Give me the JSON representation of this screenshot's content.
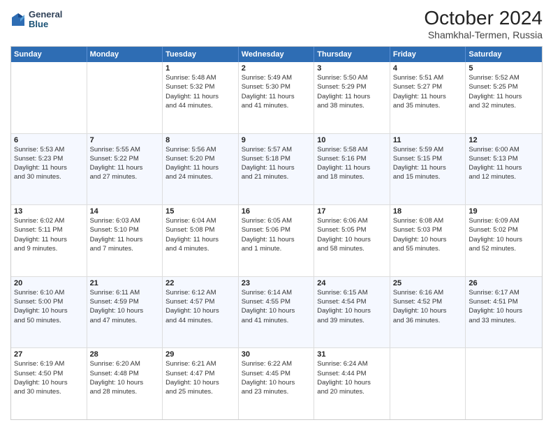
{
  "logo": {
    "line1": "General",
    "line2": "Blue"
  },
  "title": "October 2024",
  "subtitle": "Shamkhal-Termen, Russia",
  "header_days": [
    "Sunday",
    "Monday",
    "Tuesday",
    "Wednesday",
    "Thursday",
    "Friday",
    "Saturday"
  ],
  "rows": [
    {
      "alt": false,
      "cells": [
        {
          "day": "",
          "lines": []
        },
        {
          "day": "",
          "lines": []
        },
        {
          "day": "1",
          "lines": [
            "Sunrise: 5:48 AM",
            "Sunset: 5:32 PM",
            "Daylight: 11 hours",
            "and 44 minutes."
          ]
        },
        {
          "day": "2",
          "lines": [
            "Sunrise: 5:49 AM",
            "Sunset: 5:30 PM",
            "Daylight: 11 hours",
            "and 41 minutes."
          ]
        },
        {
          "day": "3",
          "lines": [
            "Sunrise: 5:50 AM",
            "Sunset: 5:29 PM",
            "Daylight: 11 hours",
            "and 38 minutes."
          ]
        },
        {
          "day": "4",
          "lines": [
            "Sunrise: 5:51 AM",
            "Sunset: 5:27 PM",
            "Daylight: 11 hours",
            "and 35 minutes."
          ]
        },
        {
          "day": "5",
          "lines": [
            "Sunrise: 5:52 AM",
            "Sunset: 5:25 PM",
            "Daylight: 11 hours",
            "and 32 minutes."
          ]
        }
      ]
    },
    {
      "alt": true,
      "cells": [
        {
          "day": "6",
          "lines": [
            "Sunrise: 5:53 AM",
            "Sunset: 5:23 PM",
            "Daylight: 11 hours",
            "and 30 minutes."
          ]
        },
        {
          "day": "7",
          "lines": [
            "Sunrise: 5:55 AM",
            "Sunset: 5:22 PM",
            "Daylight: 11 hours",
            "and 27 minutes."
          ]
        },
        {
          "day": "8",
          "lines": [
            "Sunrise: 5:56 AM",
            "Sunset: 5:20 PM",
            "Daylight: 11 hours",
            "and 24 minutes."
          ]
        },
        {
          "day": "9",
          "lines": [
            "Sunrise: 5:57 AM",
            "Sunset: 5:18 PM",
            "Daylight: 11 hours",
            "and 21 minutes."
          ]
        },
        {
          "day": "10",
          "lines": [
            "Sunrise: 5:58 AM",
            "Sunset: 5:16 PM",
            "Daylight: 11 hours",
            "and 18 minutes."
          ]
        },
        {
          "day": "11",
          "lines": [
            "Sunrise: 5:59 AM",
            "Sunset: 5:15 PM",
            "Daylight: 11 hours",
            "and 15 minutes."
          ]
        },
        {
          "day": "12",
          "lines": [
            "Sunrise: 6:00 AM",
            "Sunset: 5:13 PM",
            "Daylight: 11 hours",
            "and 12 minutes."
          ]
        }
      ]
    },
    {
      "alt": false,
      "cells": [
        {
          "day": "13",
          "lines": [
            "Sunrise: 6:02 AM",
            "Sunset: 5:11 PM",
            "Daylight: 11 hours",
            "and 9 minutes."
          ]
        },
        {
          "day": "14",
          "lines": [
            "Sunrise: 6:03 AM",
            "Sunset: 5:10 PM",
            "Daylight: 11 hours",
            "and 7 minutes."
          ]
        },
        {
          "day": "15",
          "lines": [
            "Sunrise: 6:04 AM",
            "Sunset: 5:08 PM",
            "Daylight: 11 hours",
            "and 4 minutes."
          ]
        },
        {
          "day": "16",
          "lines": [
            "Sunrise: 6:05 AM",
            "Sunset: 5:06 PM",
            "Daylight: 11 hours",
            "and 1 minute."
          ]
        },
        {
          "day": "17",
          "lines": [
            "Sunrise: 6:06 AM",
            "Sunset: 5:05 PM",
            "Daylight: 10 hours",
            "and 58 minutes."
          ]
        },
        {
          "day": "18",
          "lines": [
            "Sunrise: 6:08 AM",
            "Sunset: 5:03 PM",
            "Daylight: 10 hours",
            "and 55 minutes."
          ]
        },
        {
          "day": "19",
          "lines": [
            "Sunrise: 6:09 AM",
            "Sunset: 5:02 PM",
            "Daylight: 10 hours",
            "and 52 minutes."
          ]
        }
      ]
    },
    {
      "alt": true,
      "cells": [
        {
          "day": "20",
          "lines": [
            "Sunrise: 6:10 AM",
            "Sunset: 5:00 PM",
            "Daylight: 10 hours",
            "and 50 minutes."
          ]
        },
        {
          "day": "21",
          "lines": [
            "Sunrise: 6:11 AM",
            "Sunset: 4:59 PM",
            "Daylight: 10 hours",
            "and 47 minutes."
          ]
        },
        {
          "day": "22",
          "lines": [
            "Sunrise: 6:12 AM",
            "Sunset: 4:57 PM",
            "Daylight: 10 hours",
            "and 44 minutes."
          ]
        },
        {
          "day": "23",
          "lines": [
            "Sunrise: 6:14 AM",
            "Sunset: 4:55 PM",
            "Daylight: 10 hours",
            "and 41 minutes."
          ]
        },
        {
          "day": "24",
          "lines": [
            "Sunrise: 6:15 AM",
            "Sunset: 4:54 PM",
            "Daylight: 10 hours",
            "and 39 minutes."
          ]
        },
        {
          "day": "25",
          "lines": [
            "Sunrise: 6:16 AM",
            "Sunset: 4:52 PM",
            "Daylight: 10 hours",
            "and 36 minutes."
          ]
        },
        {
          "day": "26",
          "lines": [
            "Sunrise: 6:17 AM",
            "Sunset: 4:51 PM",
            "Daylight: 10 hours",
            "and 33 minutes."
          ]
        }
      ]
    },
    {
      "alt": false,
      "cells": [
        {
          "day": "27",
          "lines": [
            "Sunrise: 6:19 AM",
            "Sunset: 4:50 PM",
            "Daylight: 10 hours",
            "and 30 minutes."
          ]
        },
        {
          "day": "28",
          "lines": [
            "Sunrise: 6:20 AM",
            "Sunset: 4:48 PM",
            "Daylight: 10 hours",
            "and 28 minutes."
          ]
        },
        {
          "day": "29",
          "lines": [
            "Sunrise: 6:21 AM",
            "Sunset: 4:47 PM",
            "Daylight: 10 hours",
            "and 25 minutes."
          ]
        },
        {
          "day": "30",
          "lines": [
            "Sunrise: 6:22 AM",
            "Sunset: 4:45 PM",
            "Daylight: 10 hours",
            "and 23 minutes."
          ]
        },
        {
          "day": "31",
          "lines": [
            "Sunrise: 6:24 AM",
            "Sunset: 4:44 PM",
            "Daylight: 10 hours",
            "and 20 minutes."
          ]
        },
        {
          "day": "",
          "lines": []
        },
        {
          "day": "",
          "lines": []
        }
      ]
    }
  ]
}
